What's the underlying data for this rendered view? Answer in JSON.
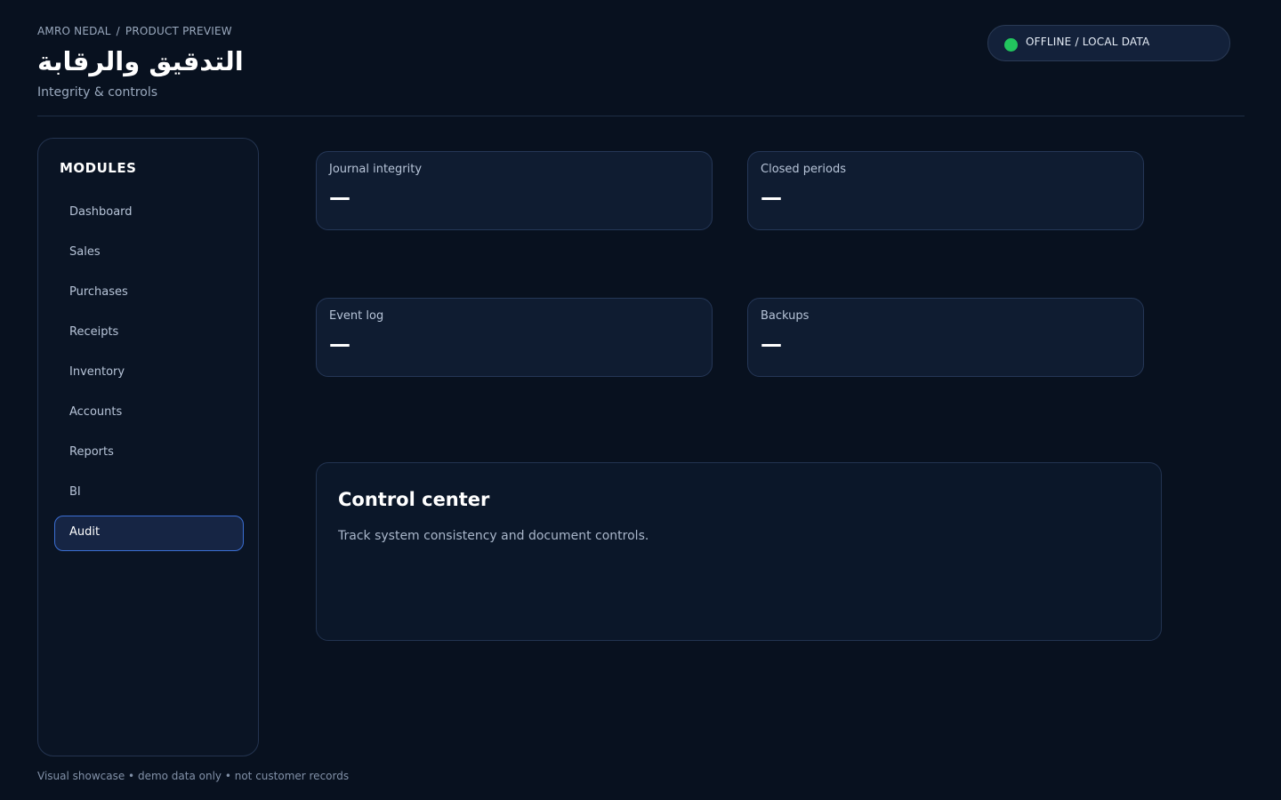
{
  "header": {
    "breadcrumb": {
      "root": "AMRO NEDAL",
      "separator": "/",
      "current": "PRODUCT PREVIEW"
    },
    "title": "التدقيق والرقابة",
    "subtitle": "Integrity & controls",
    "status": {
      "label": "OFFLINE / LOCAL DATA",
      "dot_color": "#22c55e"
    }
  },
  "sidebar": {
    "title": "MODULES",
    "items": [
      {
        "label": "Dashboard",
        "active": false
      },
      {
        "label": "Sales",
        "active": false
      },
      {
        "label": "Purchases",
        "active": false
      },
      {
        "label": "Receipts",
        "active": false
      },
      {
        "label": "Inventory",
        "active": false
      },
      {
        "label": "Accounts",
        "active": false
      },
      {
        "label": "Reports",
        "active": false
      },
      {
        "label": "BI",
        "active": false
      },
      {
        "label": "Audit",
        "active": true
      }
    ]
  },
  "stats": [
    {
      "label": "Journal integrity",
      "value": "—"
    },
    {
      "label": "Closed periods",
      "value": "—"
    },
    {
      "label": "Event log",
      "value": "—"
    },
    {
      "label": "Backups",
      "value": "—"
    }
  ],
  "control_center": {
    "title": "Control center",
    "description": "Track system consistency and document controls."
  },
  "footer": {
    "note": "Visual showcase • demo data only • not customer records"
  },
  "colors": {
    "background": "#08111f",
    "accent": "#3b6fd4",
    "status_online": "#22c55e"
  }
}
